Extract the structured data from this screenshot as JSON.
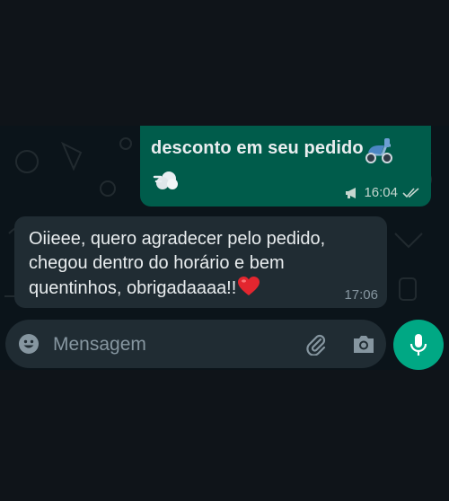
{
  "outgoing": {
    "text": "desconto em seu pedido",
    "time": "16:04",
    "icons": [
      "scooter-emoji",
      "dash-emoji",
      "megaphone-icon",
      "double-check-icon"
    ]
  },
  "incoming": {
    "lines": [
      "Oiieee, quero agradecer pelo pedido,",
      "chegou dentro do horário e bem",
      "quentinhos, obrigadaaaa!!"
    ],
    "time": "17:06",
    "icons": [
      "red-heart-emoji"
    ]
  },
  "composer": {
    "placeholder": "Mensagem",
    "icons": [
      "emoji-icon",
      "paperclip-icon",
      "camera-icon",
      "microphone-icon"
    ]
  },
  "colors": {
    "outgoing_bubble": "#005c4b",
    "incoming_bubble": "#202c33",
    "accent": "#00a884",
    "background": "#0b141a"
  }
}
